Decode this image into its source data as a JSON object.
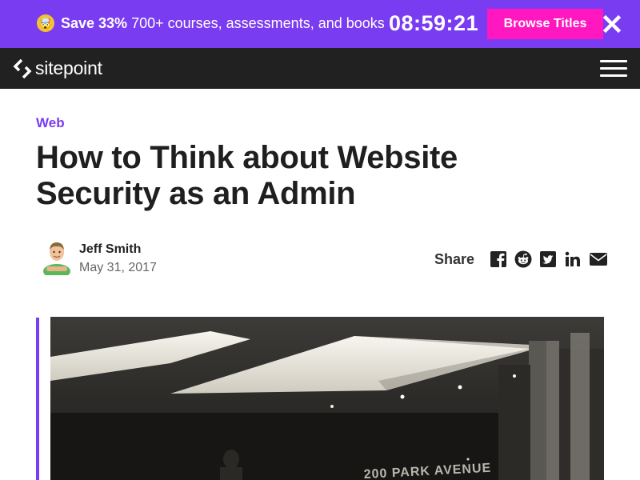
{
  "promo": {
    "emoji": "🤯",
    "highlight": "Save 33%",
    "text": " 700+ courses, assessments, and books",
    "timer": "08:59:21",
    "cta_label": "Browse Titles",
    "colors": {
      "background": "#7a3cf0",
      "cta": "#ff17c0"
    }
  },
  "nav": {
    "logo_text": "sitepoint",
    "menu_icon": "hamburger-icon",
    "background": "#212121"
  },
  "article": {
    "category": "Web",
    "title": "How to Think about Website Security as an Admin",
    "author": {
      "name": "Jeff Smith",
      "date": "May 31, 2017"
    },
    "share": {
      "label": "Share",
      "icons": [
        "facebook-icon",
        "reddit-icon",
        "twitter-icon",
        "linkedin-icon",
        "email-icon"
      ]
    },
    "accent_color": "#7a3cf0",
    "hero_sign_text": "200 PARK AVENUE"
  }
}
